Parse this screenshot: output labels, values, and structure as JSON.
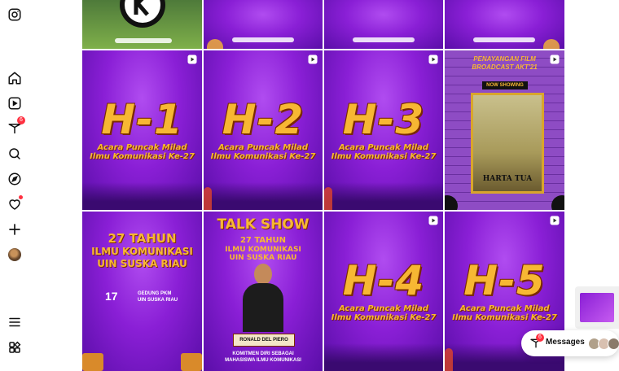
{
  "sidebar": {
    "items": [
      {
        "name": "instagram-logo-icon"
      },
      {
        "name": "home-icon"
      },
      {
        "name": "reels-icon"
      },
      {
        "name": "notifications-icon",
        "badge": "6"
      },
      {
        "name": "search-icon"
      },
      {
        "name": "explore-icon"
      },
      {
        "name": "heart-icon"
      },
      {
        "name": "create-icon"
      },
      {
        "name": "profile-avatar"
      },
      {
        "name": "more-menu-icon"
      },
      {
        "name": "also-from-meta-icon"
      }
    ]
  },
  "grid": {
    "tiles": [
      {
        "id": "top-1",
        "type": "logo"
      },
      {
        "id": "top-2",
        "type": "confetti"
      },
      {
        "id": "top-3",
        "type": "confetti"
      },
      {
        "id": "top-4",
        "type": "confetti"
      },
      {
        "id": "r1c1",
        "type": "countdown",
        "big": "H-1",
        "line1": "Acara Puncak Milad",
        "line2": "Ilmu Komunikasi Ke-27",
        "reel": true
      },
      {
        "id": "r1c2",
        "type": "countdown",
        "big": "H-2",
        "line1": "Acara Puncak Milad",
        "line2": "Ilmu Komunikasi Ke-27",
        "reel": true
      },
      {
        "id": "r1c3",
        "type": "countdown",
        "big": "H-3",
        "line1": "Acara Puncak Milad",
        "line2": "Ilmu Komunikasi Ke-27",
        "reel": true
      },
      {
        "id": "r1c4",
        "type": "film",
        "headline1": "PENAYANGAN FILM",
        "headline2": "BROADCAST AKT'21",
        "ribbon": "NOW SHOWING",
        "poster_title": "HARTA TUA",
        "reel": true
      },
      {
        "id": "r2c1",
        "type": "event",
        "title1": "27 TAHUN",
        "title2": "ILMU KOMUNIKASI",
        "title3": "UIN SUSKA RIAU",
        "date": "17",
        "venue1": "GEDUNG PKM",
        "venue2": "UIN SUSKA RIAU"
      },
      {
        "id": "r2c2",
        "type": "talkshow",
        "title": "TALK SHOW",
        "title1": "27 TAHUN",
        "title2": "ILMU KOMUNIKASI",
        "title3": "UIN SUSKA RIAU",
        "speaker": "RONALD DEL PIERO",
        "tagline1": "KOMITMEN DIRI SEBAGAI",
        "tagline2": "MAHASISWA ILMU KOMUNIKASI"
      },
      {
        "id": "r2c3",
        "type": "countdown",
        "big": "H-4",
        "line1": "Acara Puncak Milad",
        "line2": "Ilmu Komunikasi Ke-27",
        "reel": true
      },
      {
        "id": "r2c4",
        "type": "countdown",
        "big": "H-5",
        "line1": "Acara Puncak Milad",
        "line2": "Ilmu Komunikasi Ke-27",
        "reel": true
      }
    ]
  },
  "messages": {
    "label": "Messages",
    "badge": "6"
  },
  "colors": {
    "accent_gold": "#f7b733",
    "purple": "#8a1fd6",
    "badge_red": "#ff3040"
  }
}
